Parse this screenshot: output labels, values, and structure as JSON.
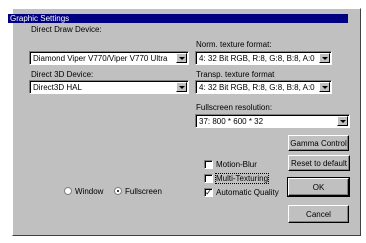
{
  "title": "Graphic Settings",
  "direct_draw": {
    "label": "Direct Draw Device:",
    "value": "Diamond Viper V770/Viper V770 Ultra"
  },
  "direct_3d": {
    "label": "Direct 3D Device:",
    "value": "Direct3D HAL"
  },
  "norm_texture": {
    "label": "Norm. texture format:",
    "value": "4: 32 Bit RGB, R:8, G:8, B:8, A:0"
  },
  "transp_texture": {
    "label": "Transp. texture format",
    "value": "4: 32 Bit RGB, R:8, G:8, B:8, A:0"
  },
  "fullscreen_res": {
    "label": "Fullscreen resolution:",
    "value": "37: 800 * 600 * 32"
  },
  "buttons": {
    "gamma": "Gamma Control",
    "reset": "Reset to default",
    "ok": "OK",
    "cancel": "Cancel"
  },
  "checkboxes": [
    {
      "label": "Motion-Blur",
      "checked": false
    },
    {
      "label": "Multi-Texturing",
      "checked": false
    },
    {
      "label": "Automatic Quality",
      "checked": true
    }
  ],
  "display_mode": {
    "window_label": "Window",
    "fullscreen_label": "Fullscreen",
    "selected": "Fullscreen"
  },
  "check_glyph": "✓"
}
